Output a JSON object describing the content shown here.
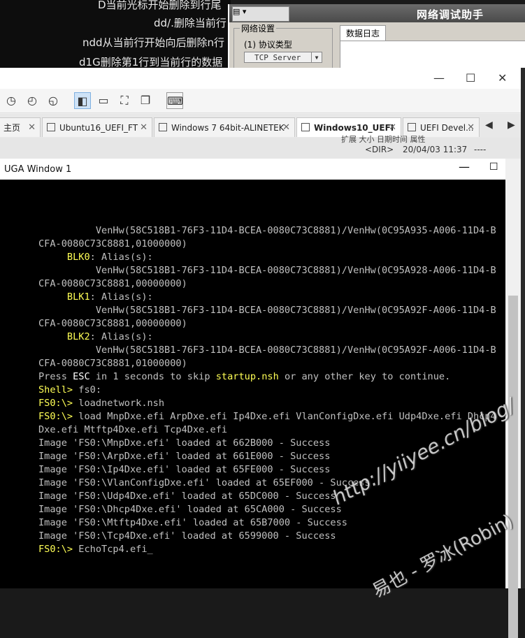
{
  "background_notes": [
    "D当前光标开始删除到行尾",
    "dd/.删除当前行",
    "ndd从当前行开始向后删除n行",
    "d1G删除第1行到当前行的数据"
  ],
  "net_assistant": {
    "title": "网络调试助手",
    "menu_label": "▤ ▾",
    "network_settings_label": "网络设置",
    "protocol_label": "(1) 协议类型",
    "protocol_value": "TCP Server",
    "data_log_tab": "数据日志"
  },
  "vm": {
    "window_controls": {
      "minimize": "—",
      "maximize": "☐",
      "close": "✕"
    },
    "tabs": [
      {
        "label": "主页"
      },
      {
        "label": "Ubuntu16_UEFI_FT"
      },
      {
        "label": "Windows 7 64bit-ALINETEK"
      },
      {
        "label": "Windows10_UEFI"
      },
      {
        "label": "UEFI Devel..."
      }
    ],
    "file_strip": {
      "header_fragment": "扩展 大小    日期时间      属性",
      "dir": "<DIR>",
      "date": "20/04/03 11:37",
      "attr": "----"
    },
    "uga_title": "UGA Window 1"
  },
  "console_lines": [
    {
      "indent": "          ",
      "segs": [
        {
          "t": "VenHw(58C518B1-76F3-11D4-BCEA-0080C73C8881)/VenHw(0C95A935-A006-11D4-B",
          "y": false
        }
      ]
    },
    {
      "indent": "",
      "segs": [
        {
          "t": "CFA-0080C73C8881,01000000)",
          "y": false
        }
      ]
    },
    {
      "indent": "     ",
      "segs": [
        {
          "t": "BLK0",
          "y": true
        },
        {
          "t": ": Alias(s):",
          "y": false
        }
      ]
    },
    {
      "indent": "          ",
      "segs": [
        {
          "t": "VenHw(58C518B1-76F3-11D4-BCEA-0080C73C8881)/VenHw(0C95A928-A006-11D4-B",
          "y": false
        }
      ]
    },
    {
      "indent": "",
      "segs": [
        {
          "t": "CFA-0080C73C8881,00000000)",
          "y": false
        }
      ]
    },
    {
      "indent": "     ",
      "segs": [
        {
          "t": "BLK1",
          "y": true
        },
        {
          "t": ": Alias(s):",
          "y": false
        }
      ]
    },
    {
      "indent": "          ",
      "segs": [
        {
          "t": "VenHw(58C518B1-76F3-11D4-BCEA-0080C73C8881)/VenHw(0C95A92F-A006-11D4-B",
          "y": false
        }
      ]
    },
    {
      "indent": "",
      "segs": [
        {
          "t": "CFA-0080C73C8881,00000000)",
          "y": false
        }
      ]
    },
    {
      "indent": "     ",
      "segs": [
        {
          "t": "BLK2",
          "y": true
        },
        {
          "t": ": Alias(s):",
          "y": false
        }
      ]
    },
    {
      "indent": "          ",
      "segs": [
        {
          "t": "VenHw(58C518B1-76F3-11D4-BCEA-0080C73C8881)/VenHw(0C95A92F-A006-11D4-B",
          "y": false
        }
      ]
    },
    {
      "indent": "",
      "segs": [
        {
          "t": "CFA-0080C73C8881,01000000)",
          "y": false
        }
      ]
    },
    {
      "indent": "",
      "segs": [
        {
          "t": "Press ",
          "y": false
        },
        {
          "t": "ESC",
          "y": false,
          "w": true
        },
        {
          "t": " in 1 seconds to skip ",
          "y": false
        },
        {
          "t": "startup.nsh",
          "y": true
        },
        {
          "t": " or any other key to continue.",
          "y": false
        }
      ]
    },
    {
      "indent": "",
      "segs": [
        {
          "t": "Shell>",
          "y": true
        },
        {
          "t": " fs0:",
          "y": false
        }
      ]
    },
    {
      "indent": "",
      "segs": [
        {
          "t": "FS0:\\>",
          "y": true
        },
        {
          "t": " loadnetwork.nsh",
          "y": false
        }
      ]
    },
    {
      "indent": "",
      "segs": [
        {
          "t": "FS0:\\>",
          "y": true
        },
        {
          "t": " load MnpDxe.efi ArpDxe.efi Ip4Dxe.efi VlanConfigDxe.efi Udp4Dxe.efi Dhcp4",
          "y": false
        }
      ]
    },
    {
      "indent": "",
      "segs": [
        {
          "t": "Dxe.efi Mtftp4Dxe.efi Tcp4Dxe.efi",
          "y": false
        }
      ]
    },
    {
      "indent": "",
      "segs": [
        {
          "t": "Image 'FS0:\\MnpDxe.efi' loaded at 662B000 - Success",
          "y": false
        }
      ]
    },
    {
      "indent": "",
      "segs": [
        {
          "t": "Image 'FS0:\\ArpDxe.efi' loaded at 661E000 - Success",
          "y": false
        }
      ]
    },
    {
      "indent": "",
      "segs": [
        {
          "t": "Image 'FS0:\\Ip4Dxe.efi' loaded at 65FE000 - Success",
          "y": false
        }
      ]
    },
    {
      "indent": "",
      "segs": [
        {
          "t": "Image 'FS0:\\VlanConfigDxe.efi' loaded at 65EF000 - Success",
          "y": false
        }
      ]
    },
    {
      "indent": "",
      "segs": [
        {
          "t": "Image 'FS0:\\Udp4Dxe.efi' loaded at 65DC000 - Success",
          "y": false
        }
      ]
    },
    {
      "indent": "",
      "segs": [
        {
          "t": "Image 'FS0:\\Dhcp4Dxe.efi' loaded at 65CA000 - Success",
          "y": false
        }
      ]
    },
    {
      "indent": "",
      "segs": [
        {
          "t": "Image 'FS0:\\Mtftp4Dxe.efi' loaded at 65B7000 - Success",
          "y": false
        }
      ]
    },
    {
      "indent": "",
      "segs": [
        {
          "t": "Image 'FS0:\\Tcp4Dxe.efi' loaded at 6599000 - Success",
          "y": false
        }
      ]
    },
    {
      "indent": "",
      "segs": [
        {
          "t": "FS0:\\>",
          "y": true
        },
        {
          "t": " EchoTcp4.efi_",
          "y": false
        }
      ]
    }
  ],
  "watermark": {
    "url": "http://yiiyee.cn/blog/",
    "author": "易也 - 罗冰(Robin)"
  }
}
